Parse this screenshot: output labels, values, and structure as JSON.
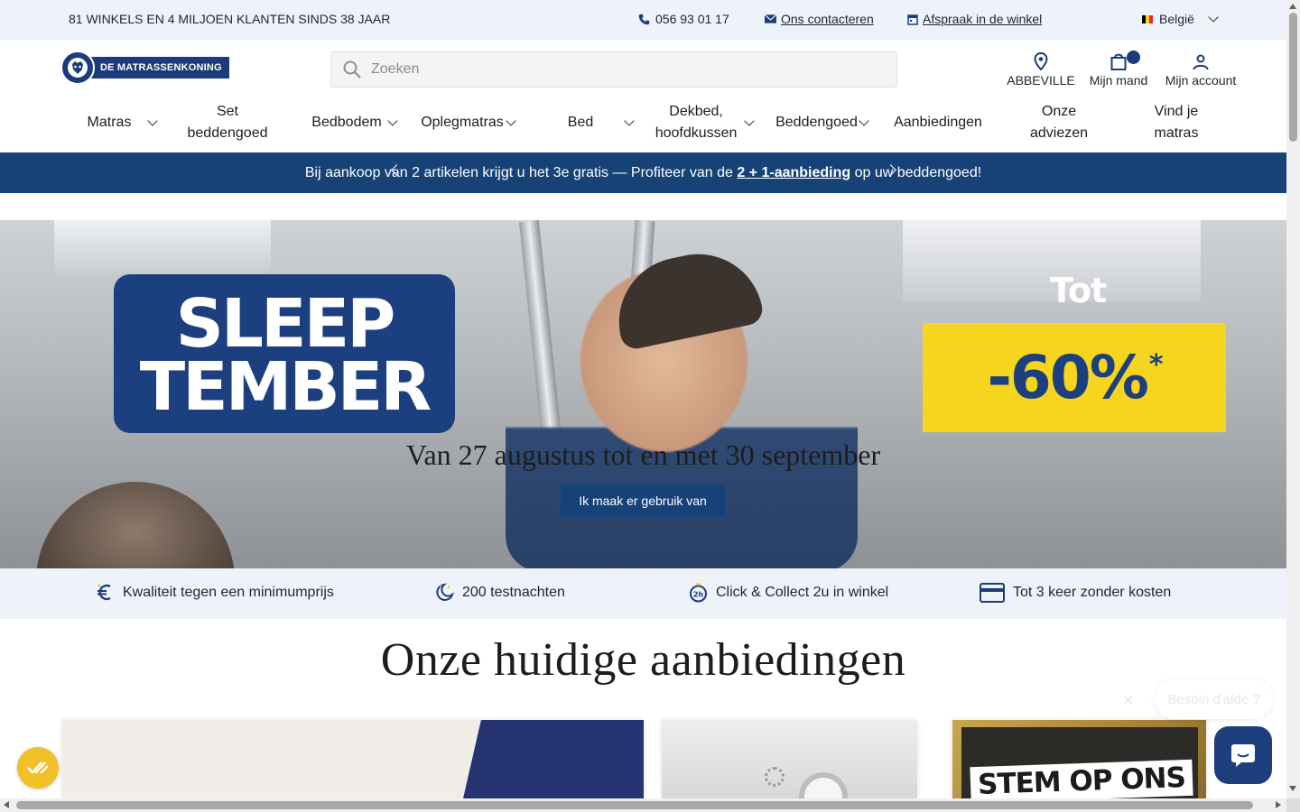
{
  "topbar": {
    "tagline": "81 WINKELS EN 4 MILJOEN KLANTEN SINDS 38 JAAR",
    "phone": "056 93 01 17",
    "contact": "Ons contacteren",
    "appointment": "Afspraak in de winkel",
    "country": "België",
    "flag_colors": [
      "#000000",
      "#f6d51e",
      "#e4262f"
    ]
  },
  "header": {
    "logo_text": "DE MATRASSENKONING",
    "search_placeholder": "Zoeken",
    "store_label": "ABBEVILLE",
    "cart_label": "Mijn mand",
    "account_label": "Mijn account"
  },
  "nav": {
    "matras": "Matras",
    "set_beddengoed": "Set beddengoed",
    "bedbodem": "Bedbodem",
    "oplegmatras": "Oplegmatras",
    "bed": "Bed",
    "dekbed": "Dekbed, hoofdkussen",
    "beddengoed": "Beddengoed",
    "aanbiedingen": "Aanbiedingen",
    "onze_adviezen": "Onze adviezen",
    "vind_je_matras": "Vind je matras"
  },
  "promo": {
    "text_before": "Bij aankoop van 2 artikelen krijgt u het 3e gratis — Profiteer van de ",
    "link": "2 + 1-aanbieding",
    "text_after": " op uw beddengoed!"
  },
  "hero": {
    "campaign_line1": "SLEEP",
    "campaign_line2": "TEMBER",
    "tot": "Tot",
    "discount": "-60%",
    "discount_mark": "*",
    "dates": "Van 27 augustus tot en met 30 september",
    "cta": "Ik maak er gebruik van"
  },
  "usp": {
    "quality": "Kwaliteit tegen een minimumprijs",
    "nights": "200 testnachten",
    "collect": "Click & Collect 2u in winkel",
    "payment": "Tot 3 keer zonder kosten"
  },
  "offers": {
    "title": "Onze huidige aanbiedingen",
    "card3_text": "STEM OP ONS"
  },
  "chat": {
    "bubble_text": "Besoin d'aide ?"
  },
  "colors": {
    "brand_navy": "#164278",
    "promo_yellow": "#f6d51e",
    "light_band": "#eef3fa"
  }
}
